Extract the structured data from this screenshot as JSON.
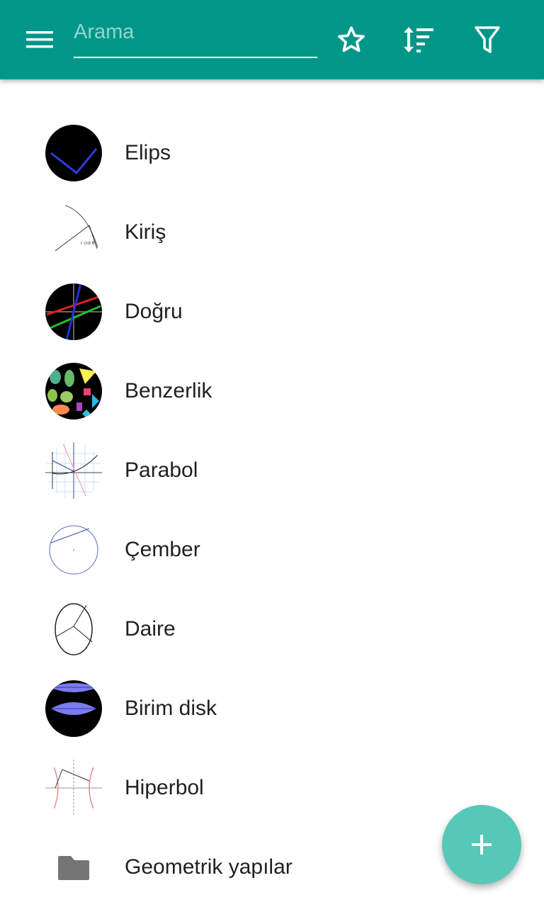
{
  "header": {
    "search_placeholder": "Arama",
    "menu_icon": "menu-icon",
    "favorites_icon": "star-outline-icon",
    "sort_icon": "sort-icon",
    "filter_icon": "filter-icon",
    "background_color": "#009688"
  },
  "items": [
    {
      "label": "Elips",
      "icon": "ellipse-thumbnail"
    },
    {
      "label": "Kiriş",
      "icon": "chord-thumbnail"
    },
    {
      "label": "Doğru",
      "icon": "line-thumbnail"
    },
    {
      "label": "Benzerlik",
      "icon": "similarity-thumbnail"
    },
    {
      "label": "Parabol",
      "icon": "parabola-thumbnail"
    },
    {
      "label": "Çember",
      "icon": "circle-thumbnail"
    },
    {
      "label": "Daire",
      "icon": "disk-thumbnail"
    },
    {
      "label": "Birim disk",
      "icon": "unit-disk-thumbnail"
    },
    {
      "label": "Hiperbol",
      "icon": "hyperbola-thumbnail"
    },
    {
      "label": "Geometrik yapılar",
      "icon": "folder-icon"
    }
  ],
  "fab": {
    "icon": "plus-icon",
    "color": "#56c8b8"
  }
}
